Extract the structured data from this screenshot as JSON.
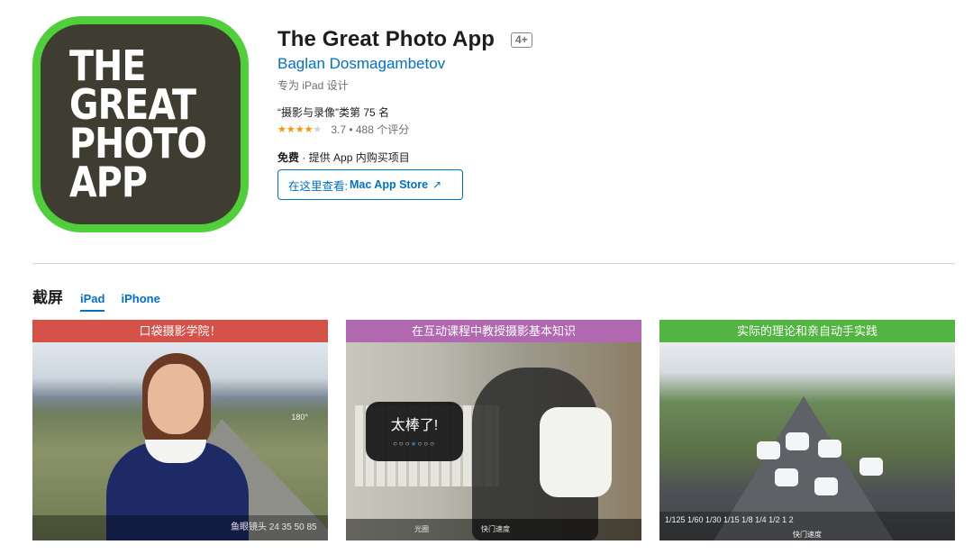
{
  "app": {
    "icon_lines": [
      "THE",
      "GREAT",
      "PHOTO",
      "APP"
    ],
    "title": "The Great Photo App",
    "age_rating": "4+",
    "developer": "Baglan Dosmagambetov",
    "designed_for": "专为 iPad 设计",
    "rank": "“摄影与录像”类第 75 名",
    "rating_value": "3.7",
    "rating_count": "488 个评分",
    "rating_text": "3.7 • 488 个评分",
    "stars_filled": 3.7,
    "price": "免费",
    "iap": " · 提供 App 内购买项目",
    "mac_button_prefix": "在这里查看:",
    "mac_button_store": "Mac App Store",
    "mac_button_arrow": "↗"
  },
  "screenshots": {
    "title": "截屏",
    "tabs": [
      "iPad",
      "iPhone"
    ],
    "active_tab": "iPad",
    "items": [
      {
        "caption": "口袋摄影学院！",
        "bar_text": "鱼眼镜头        24    35    50    85",
        "dial": "180°",
        "caption_color": "#d4524a"
      },
      {
        "caption": "在互动课程中教授摄影基本知识",
        "toast": "太棒了!",
        "bar_label_1": "光圈",
        "bar_label_2": "快门速度",
        "caption_color": "#b267b1"
      },
      {
        "caption": "实际的理论和亲自动手实践",
        "ticks": "1/125   1/60   1/30   1/15   1/8   1/4   1/2   1   2",
        "bar_label": "快门速度",
        "caption_color": "#52b542"
      }
    ]
  },
  "colors": {
    "link": "#0070c9",
    "icon_border": "#4fd03a",
    "icon_bg": "#3f3d32",
    "star": "#ff9500"
  }
}
